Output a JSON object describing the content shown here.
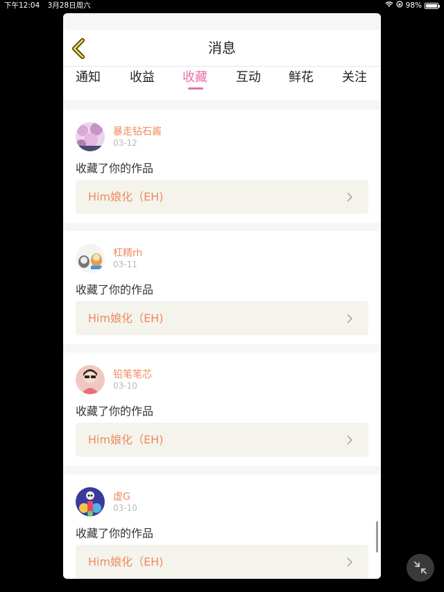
{
  "status_bar": {
    "time": "下午12:04",
    "date": "3月28日周六",
    "battery": "98%",
    "battery_level": 0.98
  },
  "header": {
    "title": "消息",
    "back_icon": "chevron-left-icon"
  },
  "tabs": [
    {
      "label": "通知",
      "active": false
    },
    {
      "label": "收益",
      "active": false
    },
    {
      "label": "收藏",
      "active": true
    },
    {
      "label": "互动",
      "active": false
    },
    {
      "label": "鲜花",
      "active": false
    },
    {
      "label": "关注",
      "active": false
    }
  ],
  "messages": [
    {
      "user": "暴走钻石酱",
      "date": "03-12",
      "action": "收藏了你的作品",
      "work": "Him娘化（EH)"
    },
    {
      "user": "杠精rh",
      "date": "03-11",
      "action": "收藏了你的作品",
      "work": "Him娘化（EH)"
    },
    {
      "user": "铅笔笔芯",
      "date": "03-10",
      "action": "收藏了你的作品",
      "work": "Him娘化（EH)"
    },
    {
      "user": "虚G",
      "date": "03-10",
      "action": "收藏了你的作品",
      "work": "Him娘化（EH)"
    }
  ],
  "colors": {
    "accent": "#e66fa8",
    "username": "#ef8a5e",
    "link_bg": "#f4f3ec"
  }
}
